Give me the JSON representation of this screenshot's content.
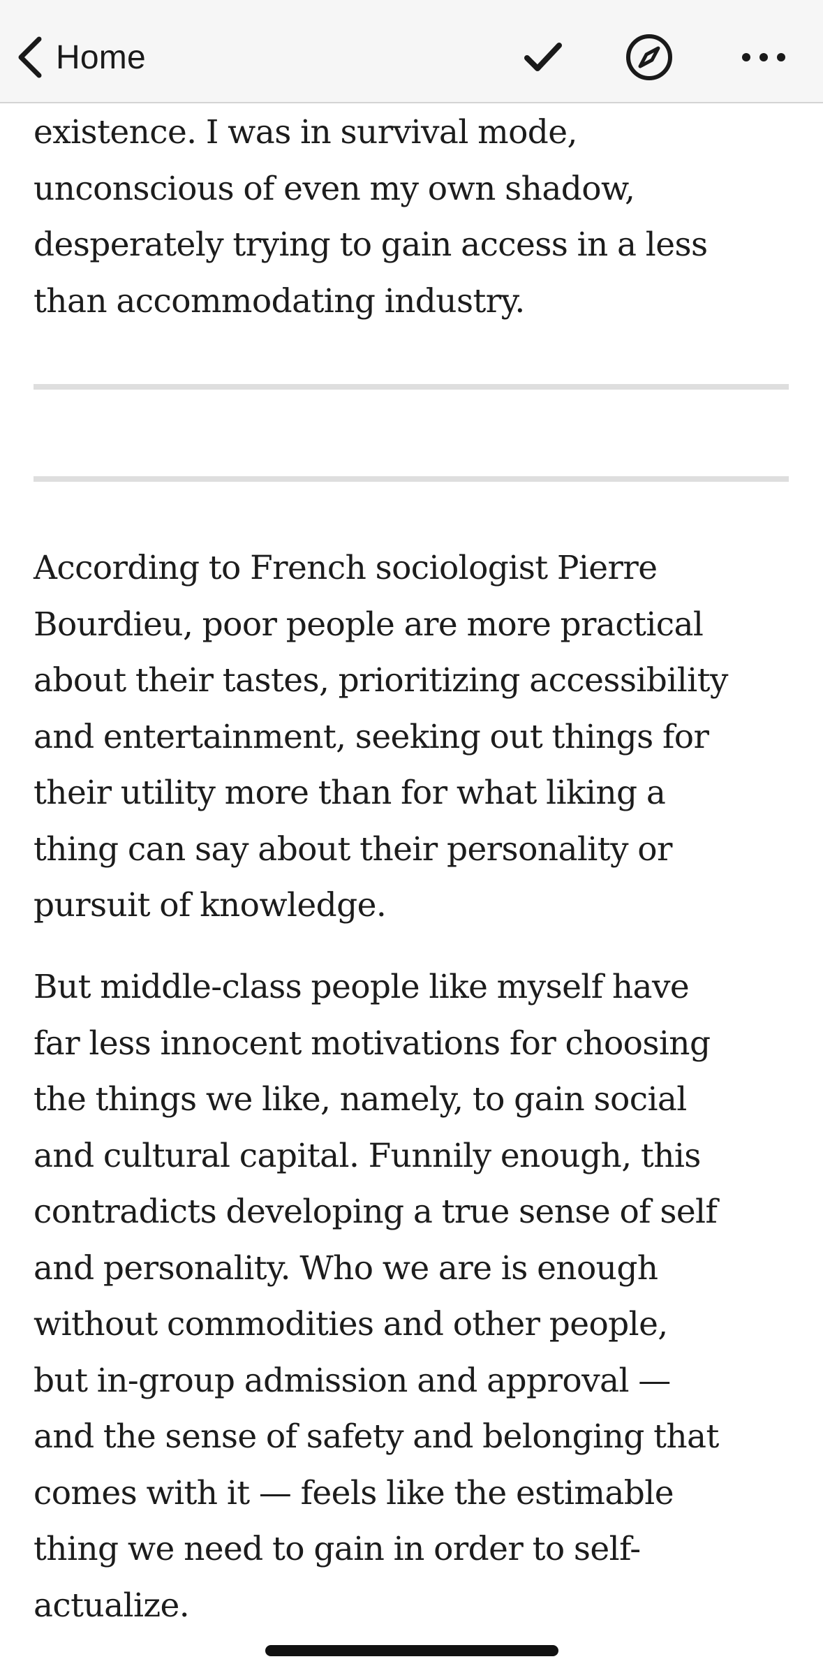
{
  "navbar": {
    "back_label": "Home",
    "icons": [
      "chevron-left-icon",
      "checkmark-icon",
      "compass-icon",
      "more-icon"
    ]
  },
  "article": {
    "intro_lines": [
      "existence. I was in survival mode,",
      "unconscious of even my own shadow,",
      "desperately trying to gain access in a less",
      "than accommodating industry."
    ],
    "paragraph_1_lines": [
      "According to French sociologist Pierre",
      "Bourdieu, poor people are more practical",
      "about their tastes, prioritizing accessibility",
      "and entertainment, seeking out things for",
      "their utility more than for what liking a",
      "thing can say about their personality or",
      "pursuit of knowledge."
    ],
    "paragraph_2_lines": [
      "But middle-class people like myself have",
      "far less innocent motivations for choosing",
      "the things we like, namely, to gain social",
      "and cultural capital. Funnily enough, this",
      "contradicts developing a true sense of self",
      "and personality. Who we are is enough",
      "without commodities and other people,",
      "but in-group admission and approval —",
      "and the sense of safety and belonging that",
      "comes with it — feels like the estimable",
      "thing we need to gain in order to self-",
      "actualize."
    ]
  },
  "colors": {
    "navbar_background": "#f6f6f6",
    "text": "#1c1c1c",
    "divider": "#dedede"
  }
}
